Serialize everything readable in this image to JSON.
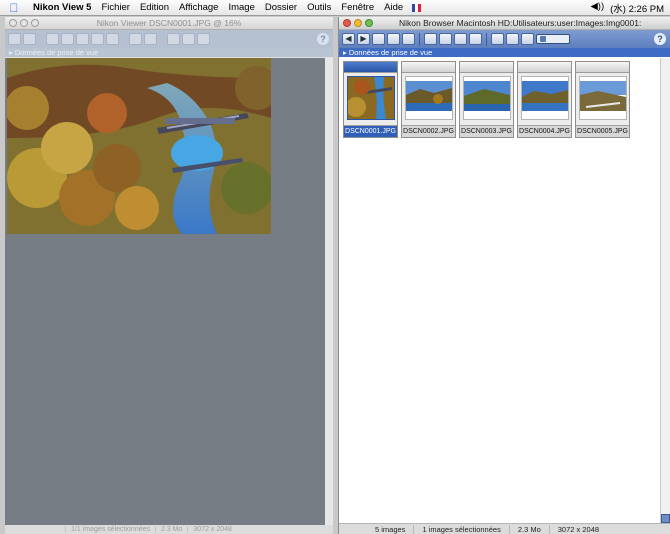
{
  "menubar": {
    "app_name": "Nikon View 5",
    "items": [
      "Fichier",
      "Edition",
      "Affichage",
      "Image",
      "Dossier",
      "Outils",
      "Fenêtre",
      "Aide"
    ],
    "volume": "◀))",
    "clock": "(水) 2:26 PM"
  },
  "viewer": {
    "title": "Nikon Viewer DSCN0001.JPG @ 16%",
    "section_label": "▸ Données de prise de vue",
    "help": "?",
    "status": {
      "selected": "1/1 images sélectionnées",
      "size": "2.3 Mo",
      "dimensions": "3072 x 2048"
    }
  },
  "browser": {
    "title": "Nikon Browser Macintosh HD:Utilisateurs:user:Images:Img0001:",
    "section_label": "▸ Données de prise de vue",
    "help": "?",
    "thumbnails": [
      {
        "label": "DSCN0001.JPG",
        "selected": true
      },
      {
        "label": "DSCN0002.JPG",
        "selected": false
      },
      {
        "label": "DSCN0003.JPG",
        "selected": false
      },
      {
        "label": "DSCN0004.JPG",
        "selected": false
      },
      {
        "label": "DSCN0005.JPG",
        "selected": false
      }
    ],
    "status": {
      "count": "5 images",
      "selected": "1 images sélectionnées",
      "size": "2.3 Mo",
      "dimensions": "3072 x 2048"
    }
  },
  "colors": {
    "selection": "#2f5fb8",
    "toolbar_active": "#5d7fbf",
    "viewer_bg": "#6f7780"
  }
}
